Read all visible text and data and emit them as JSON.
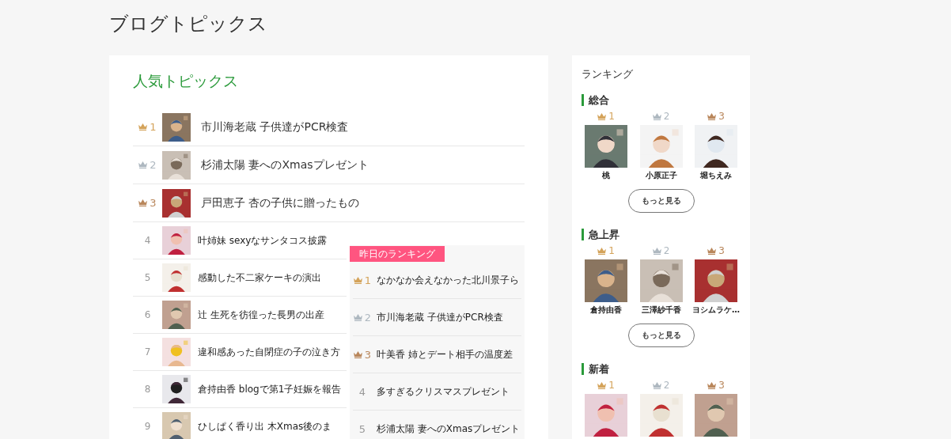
{
  "page_title": "ブログトピックス",
  "popular": {
    "title": "人気トピックス",
    "top": [
      {
        "rank": "1",
        "color": "#d4a35a",
        "text": "市川海老蔵 子供達がPCR検査"
      },
      {
        "rank": "2",
        "color": "#aeb8c0",
        "text": "杉浦太陽 妻へのXmasプレゼント"
      },
      {
        "rank": "3",
        "color": "#b9875c",
        "text": "戸田恵子 杏の子供に贈ったもの"
      }
    ],
    "rest": [
      {
        "rank": "4",
        "text": "叶姉妹 sexyなサンタコス披露"
      },
      {
        "rank": "5",
        "text": "感動した不二家ケーキの演出"
      },
      {
        "rank": "6",
        "text": "辻 生死を彷徨った長男の出産"
      },
      {
        "rank": "7",
        "text": "違和感あった自閉症の子の泣き方"
      },
      {
        "rank": "8",
        "text": "倉持由香 blogで第1子妊娠を報告"
      },
      {
        "rank": "9",
        "text": "ひしぱく香り出 木Xmas後のま"
      }
    ],
    "yesterday": {
      "tag": "昨日のランキング",
      "items": [
        {
          "rank": "1",
          "color": "#d4a35a",
          "text": "なかなか会えなかった北川景子ら"
        },
        {
          "rank": "2",
          "color": "#aeb8c0",
          "text": "市川海老蔵 子供達がPCR検査"
        },
        {
          "rank": "3",
          "color": "#b9875c",
          "text": "叶美香 姉とデート相手の温度差"
        },
        {
          "rank": "4",
          "text": "多すぎるクリスマスプレゼント"
        },
        {
          "rank": "5",
          "text": "杉浦太陽 妻へのXmasプレゼント"
        }
      ]
    }
  },
  "ranking": {
    "title": "ランキング",
    "sections": [
      {
        "title": "総合",
        "more": "もっと見る",
        "people": [
          {
            "rank": "1",
            "color": "#d4a35a",
            "name": "桃"
          },
          {
            "rank": "2",
            "color": "#aeb8c0",
            "name": "小原正子"
          },
          {
            "rank": "3",
            "color": "#b9875c",
            "name": "堀ちえみ"
          }
        ]
      },
      {
        "title": "急上昇",
        "more": "もっと見る",
        "people": [
          {
            "rank": "1",
            "color": "#d4a35a",
            "name": "倉持由香"
          },
          {
            "rank": "2",
            "color": "#aeb8c0",
            "name": "三澤紗千香"
          },
          {
            "rank": "3",
            "color": "#b9875c",
            "name": "ヨシムラケ…"
          }
        ]
      },
      {
        "title": "新着",
        "people": [
          {
            "rank": "1",
            "color": "#d4a35a"
          },
          {
            "rank": "2",
            "color": "#aeb8c0"
          },
          {
            "rank": "3",
            "color": "#b9875c"
          }
        ]
      }
    ]
  }
}
